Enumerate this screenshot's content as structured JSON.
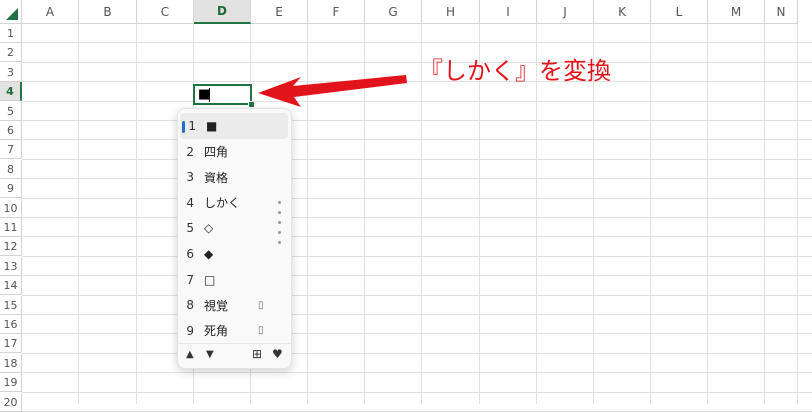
{
  "columns": [
    "A",
    "B",
    "C",
    "D",
    "E",
    "F",
    "G",
    "H",
    "I",
    "J",
    "K",
    "L",
    "M",
    "N"
  ],
  "rows": [
    "1",
    "2",
    "3",
    "4",
    "5",
    "6",
    "7",
    "8",
    "9",
    "10",
    "11",
    "12",
    "13",
    "14",
    "15",
    "16",
    "17",
    "18",
    "19",
    "20"
  ],
  "selected_column": "D",
  "selected_row": "4",
  "active_cell": {
    "value": "■"
  },
  "ime": {
    "candidates": [
      {
        "num": "1",
        "text": "■",
        "badge": ""
      },
      {
        "num": "2",
        "text": "四角",
        "badge": ""
      },
      {
        "num": "3",
        "text": "資格",
        "badge": ""
      },
      {
        "num": "4",
        "text": "しかく",
        "badge": ""
      },
      {
        "num": "5",
        "text": "◇",
        "badge": ""
      },
      {
        "num": "6",
        "text": "◆",
        "badge": ""
      },
      {
        "num": "7",
        "text": "□",
        "badge": ""
      },
      {
        "num": "8",
        "text": "視覚",
        "badge": "▯"
      },
      {
        "num": "9",
        "text": "死角",
        "badge": "▯"
      }
    ],
    "footer": {
      "up": "▲",
      "down": "▼",
      "table": "⊞",
      "dict": "♥"
    }
  },
  "annotation": {
    "text": "『しかく』を変換",
    "color": "#e0141a"
  },
  "colors": {
    "accent": "#217346",
    "ime_selection": "#1f6fc5"
  }
}
